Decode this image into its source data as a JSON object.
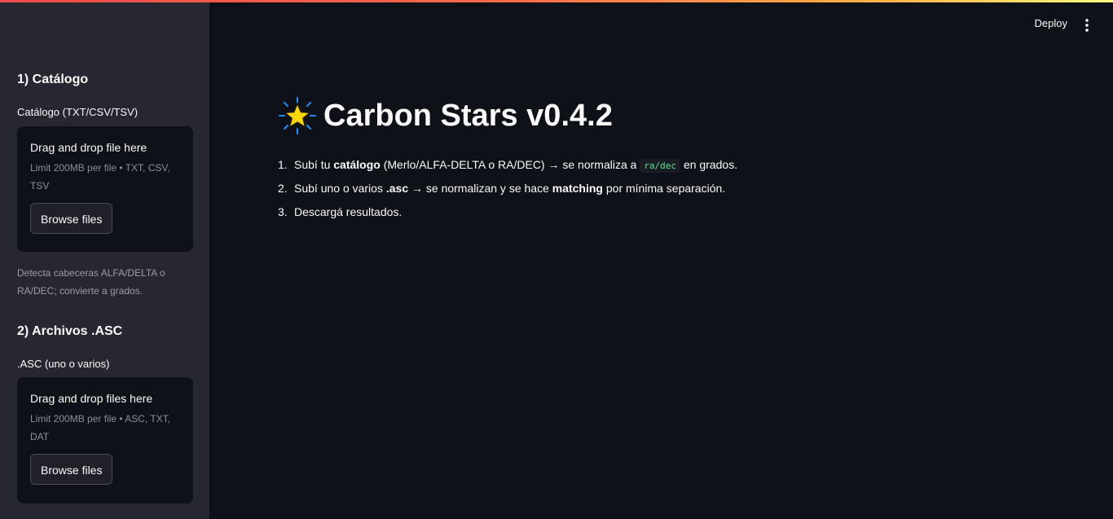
{
  "header": {
    "deploy_label": "Deploy"
  },
  "sidebar": {
    "section1": {
      "title": "1) Catálogo",
      "field_label": "Catálogo (TXT/CSV/TSV)",
      "dropzone": {
        "title": "Drag and drop file here",
        "limit": "Limit 200MB per file • TXT, CSV, TSV",
        "browse_label": "Browse files"
      },
      "caption": "Detecta cabeceras ALFA/DELTA o RA/DEC; convierte a grados."
    },
    "section2": {
      "title": "2) Archivos .ASC",
      "field_label": ".ASC (uno o varios)",
      "dropzone": {
        "title": "Drag and drop files here",
        "limit": "Limit 200MB per file • ASC, TXT, DAT",
        "browse_label": "Browse files"
      }
    }
  },
  "main": {
    "title": "Carbon Stars v0.4.2",
    "title_icon": "glowing-star-icon",
    "steps": [
      {
        "num": "1.",
        "t1": "Subí tu ",
        "b1": "catálogo",
        "t2": " (Merlo/ALFA-DELTA o RA/DEC) → se normaliza a ",
        "code": "ra/dec",
        "t3": " en grados."
      },
      {
        "num": "2.",
        "t1": "Subí uno o varios ",
        "b1": ".asc",
        "t2": " → se normalizan y se hace ",
        "b2": "matching",
        "t3": " por mínima separación."
      },
      {
        "num": "3.",
        "t1": "Descargá resultados."
      }
    ]
  },
  "colors": {
    "sidebar_bg": "#262730",
    "main_bg": "#0e1117",
    "code_text": "#5ce488",
    "accent_stripe_start": "#ff4b4b",
    "accent_stripe_end": "#fffd80"
  }
}
